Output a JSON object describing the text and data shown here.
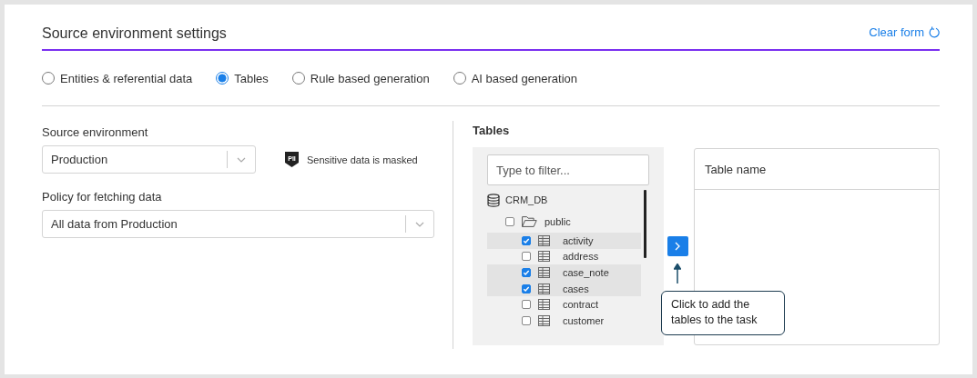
{
  "header": {
    "title": "Source environment settings",
    "clear_button": "Clear form"
  },
  "modes": [
    {
      "label": "Entities & referential data",
      "selected": false
    },
    {
      "label": "Tables",
      "selected": true
    },
    {
      "label": "Rule based generation",
      "selected": false
    },
    {
      "label": "AI based generation",
      "selected": false
    }
  ],
  "source_environment": {
    "label": "Source environment",
    "value": "Production",
    "badge": "PII",
    "note": "Sensitive data is masked"
  },
  "policy": {
    "label": "Policy for fetching data",
    "value": "All data from Production"
  },
  "tables": {
    "title": "Tables",
    "filter_placeholder": "Type to filter...",
    "tree": [
      {
        "label": "CRM_DB",
        "kind": "database",
        "children": [
          {
            "label": "public",
            "kind": "schema",
            "checked": false,
            "expanded": true,
            "children": [
              {
                "label": "activity",
                "kind": "table",
                "checked": true
              },
              {
                "label": "address",
                "kind": "table",
                "checked": false
              },
              {
                "label": "case_note",
                "kind": "table",
                "checked": true
              },
              {
                "label": "cases",
                "kind": "table",
                "checked": true
              },
              {
                "label": "contract",
                "kind": "table",
                "checked": false
              },
              {
                "label": "customer",
                "kind": "table",
                "checked": false
              }
            ]
          }
        ]
      }
    ],
    "hint": "Click to add the tables to the task",
    "selected_column": "Table name"
  }
}
